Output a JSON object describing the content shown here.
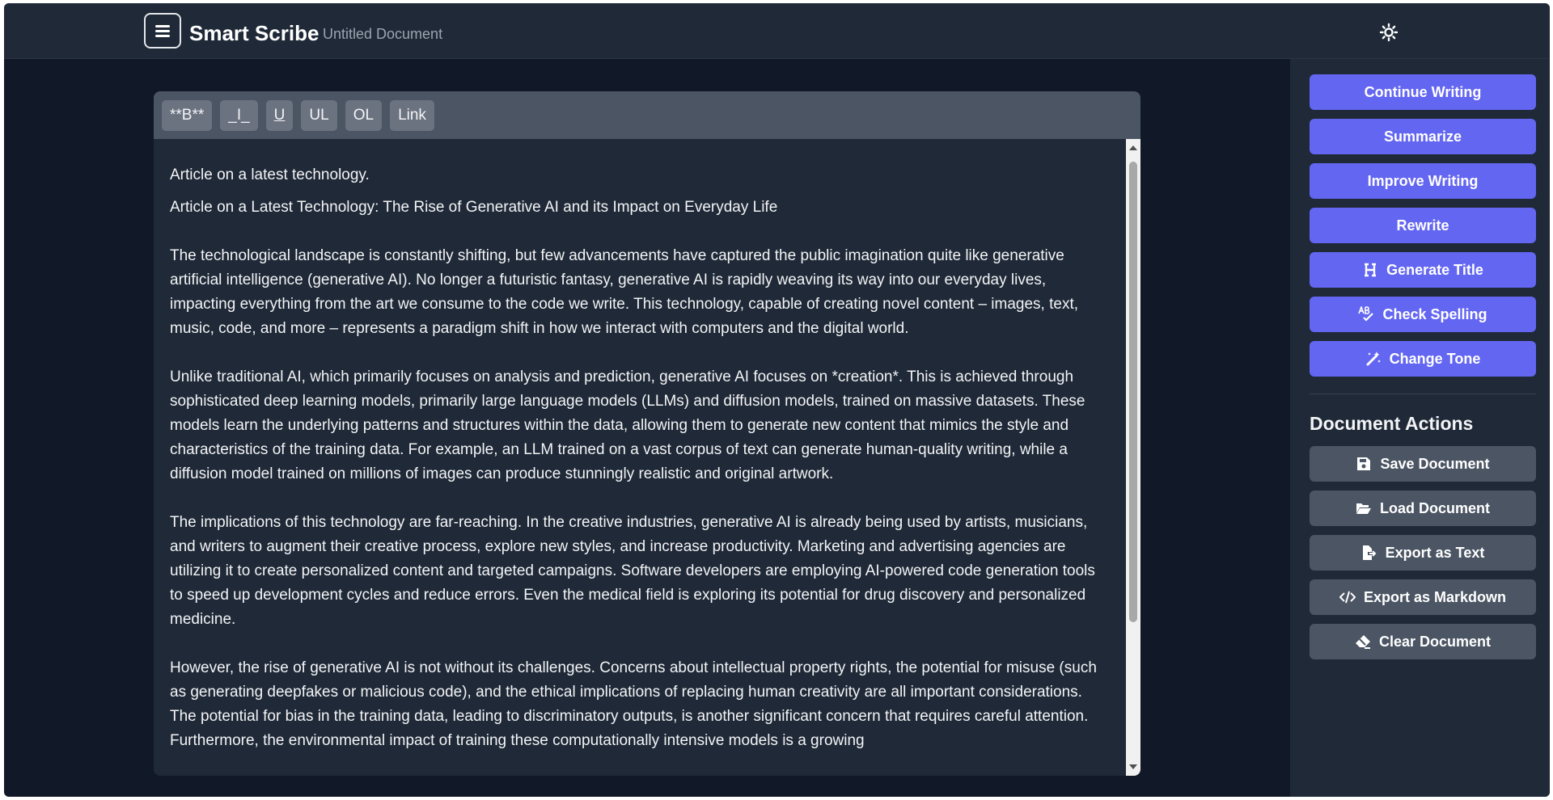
{
  "header": {
    "app_title": "Smart Scribe",
    "document_title": "Untitled Document"
  },
  "toolbar": {
    "bold": "**B**",
    "italic": "_I_",
    "underline": "U",
    "unordered_list": "UL",
    "ordered_list": "OL",
    "link": "Link"
  },
  "editor": {
    "paragraphs": [
      "Article on a latest technology.",
      "Article on a Latest Technology:  The Rise of Generative AI and its Impact on Everyday Life",
      "The technological landscape is constantly shifting, but few advancements have captured the public imagination quite like generative artificial intelligence (generative AI).  No longer a futuristic fantasy, generative AI is rapidly weaving its way into our everyday lives, impacting everything from the art we consume to the code we write.  This technology, capable of creating novel content – images, text, music, code, and more – represents a paradigm shift in how we interact with computers and the digital world.",
      "Unlike traditional AI, which primarily focuses on analysis and prediction, generative AI focuses on *creation*.  This is achieved through sophisticated deep learning models, primarily large language models (LLMs) and diffusion models, trained on massive datasets.  These models learn the underlying patterns and structures within the data, allowing them to generate new content that mimics the style and characteristics of the training data.  For example, an LLM trained on a vast corpus of text can generate human-quality writing, while a diffusion model trained on millions of images can produce stunningly realistic and original artwork.",
      "The implications of this technology are far-reaching.  In the creative industries, generative AI is already being used by artists, musicians, and writers to augment their creative process, explore new styles, and increase productivity.  Marketing and advertising agencies are utilizing it to create personalized content and targeted campaigns.  Software developers are employing AI-powered code generation tools to speed up development cycles and reduce errors.  Even the medical field is exploring its potential for drug discovery and personalized medicine.",
      "However, the rise of generative AI is not without its challenges.  Concerns about intellectual property rights, the potential for misuse (such as generating deepfakes or malicious code), and the ethical implications of replacing human creativity are all important considerations.  The potential for bias in the training data, leading to discriminatory outputs, is another significant concern that requires careful attention.  Furthermore, the environmental impact of training these computationally intensive models is a growing"
    ]
  },
  "ai_tools": {
    "continue_writing": "Continue Writing",
    "summarize": "Summarize",
    "improve_writing": "Improve Writing",
    "rewrite": "Rewrite",
    "generate_title": "Generate Title",
    "check_spelling": "Check Spelling",
    "change_tone": "Change Tone"
  },
  "document_actions": {
    "title": "Document Actions",
    "save": "Save Document",
    "load": "Load Document",
    "export_text": "Export as Text",
    "export_markdown": "Export as Markdown",
    "clear": "Clear Document"
  },
  "colors": {
    "accent": "#6366f1",
    "background": "#111827",
    "panel": "#1f2937",
    "secondary_button": "#4b5563"
  }
}
